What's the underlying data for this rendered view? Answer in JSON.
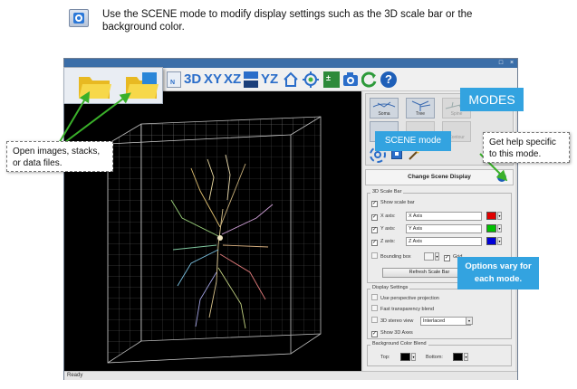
{
  "header": {
    "text": "Use the SCENE mode to modify display settings such as the 3D scale bar or the background color."
  },
  "toolbar": {
    "items": [
      "3D",
      "XY",
      "XZ",
      "YZ"
    ]
  },
  "callouts": {
    "modes": "MODES",
    "scene_mode": "SCENE mode",
    "open_files": "Open images, stacks, or data files.",
    "help": "Get help specific to this mode.",
    "options": "Options vary for each mode."
  },
  "panel": {
    "modes": {
      "soma": "Soma",
      "tree": "Tree",
      "spine": "Spine",
      "contour": "Contour"
    },
    "title": "Change Scene Display",
    "scale_bar": {
      "group": "3D Scale Bar",
      "show": "Show scale bar",
      "x_label": "X axis:",
      "x_value": "X Axis",
      "y_label": "Y axis:",
      "y_value": "Y Axis",
      "z_label": "Z axis:",
      "z_value": "Z Axis",
      "bounding_box": "Bounding box",
      "grid": "Grid",
      "refresh": "Refresh Scale Bar",
      "colors": {
        "x": "#e00000",
        "y": "#00c000",
        "z": "#0000d8"
      }
    },
    "display": {
      "group": "Display Settings",
      "perspective": "Use perspective projection",
      "transparency": "Fast transparency blend",
      "stereo": "3D stereo view",
      "stereo_value": "Interlaced",
      "axes": "Show 3D Axes"
    },
    "background": {
      "group": "Background Color Blend",
      "top": "Top:",
      "bottom": "Bottom:"
    }
  },
  "status": {
    "text": "Ready"
  },
  "colors": {
    "accent": "#33a3e0",
    "folder": "#f7d84a",
    "window_title": "#3b6ea8"
  }
}
